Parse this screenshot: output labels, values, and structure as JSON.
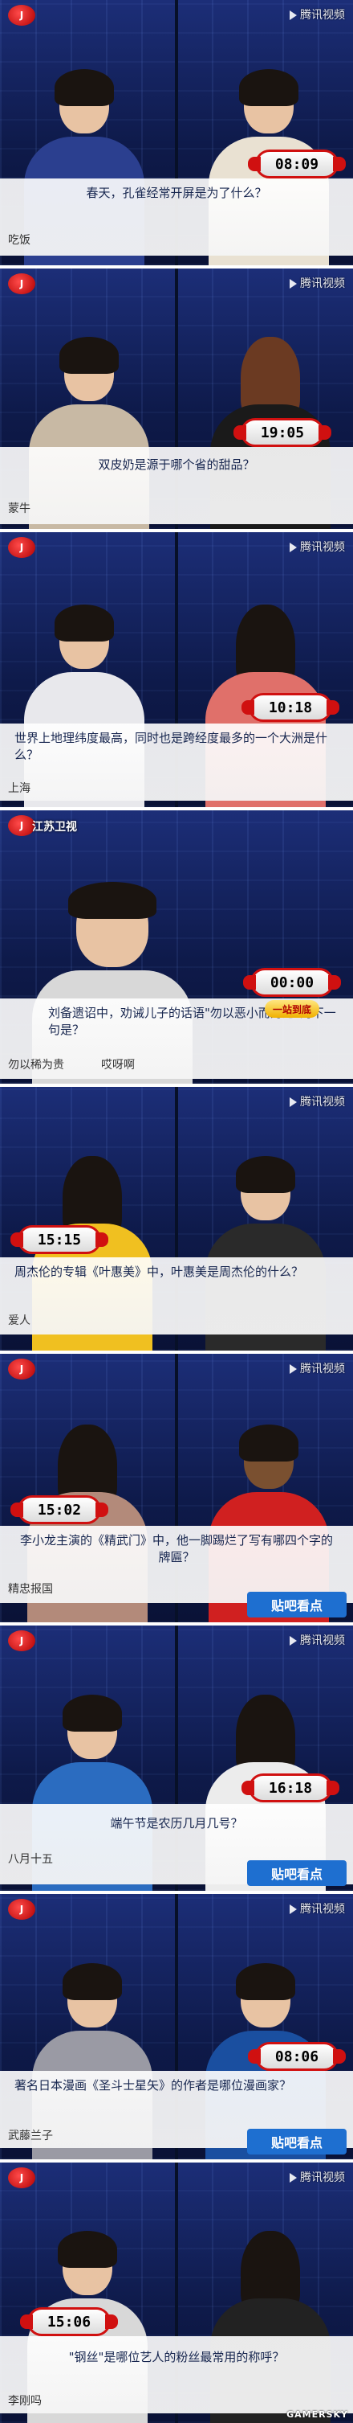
{
  "branding": {
    "tencent_video": "腾讯视频",
    "station": "江苏卫视",
    "show_banner": "一站到底",
    "tieba_button": "贴吧看点",
    "watermark": "GAMERSKY"
  },
  "panels": [
    {
      "question": "春天，孔雀经常开屏是为了什么？",
      "answer": "吃饭",
      "timer": "08:09"
    },
    {
      "question": "双皮奶是源于哪个省的甜品？",
      "answer": "蒙牛",
      "timer": "19:05"
    },
    {
      "question": "世界上地理纬度最高，同时也是跨经度最多的一个大洲是什么？",
      "answer": "上海",
      "timer": "10:18"
    },
    {
      "question": "刘备遗诏中，劝诫儿子的话语\"勿以恶小而为之\"的下一句是？",
      "answer": "勿以稀为贵",
      "answer2": "哎呀啊",
      "timer": "00:00"
    },
    {
      "question": "周杰伦的专辑《叶惠美》中，叶惠美是周杰伦的什么？",
      "answer": "爱人",
      "timer": "15:15"
    },
    {
      "question": "李小龙主演的《精武门》中，他一脚踢烂了写有哪四个字的牌匾？",
      "answer": "精忠报国",
      "timer": "15:02"
    },
    {
      "question": "端午节是农历几月几号？",
      "answer": "八月十五",
      "timer": "16:18"
    },
    {
      "question": "著名日本漫画《圣斗士星矢》的作者是哪位漫画家？",
      "answer": "武藤兰子",
      "timer": "08:06"
    },
    {
      "question": "\"钢丝\"是哪位艺人的粉丝最常用的称呼？",
      "answer": "李刚吗",
      "timer": "15:06"
    }
  ]
}
